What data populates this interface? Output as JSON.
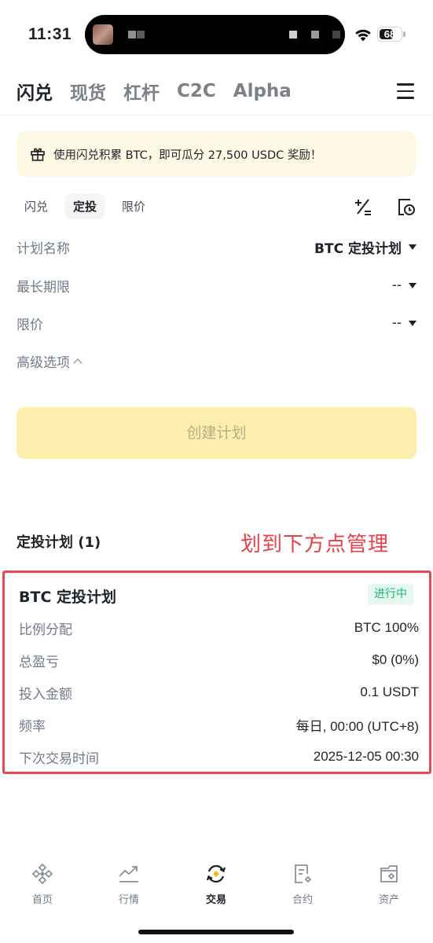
{
  "status_bar": {
    "time": "11:31",
    "battery": "68",
    "battery_level": 0.68
  },
  "top_tabs": [
    {
      "label": "闪兑",
      "active": true
    },
    {
      "label": "现货",
      "active": false
    },
    {
      "label": "杠杆",
      "active": false
    },
    {
      "label": "C2C",
      "active": false
    },
    {
      "label": "Alpha",
      "active": false
    }
  ],
  "promo": {
    "text": "使用闪兑积累 BTC，即可瓜分 27,500 USDC 奖励！",
    "icon": "gift-icon"
  },
  "sub_tabs": [
    {
      "label": "闪兑",
      "active": false
    },
    {
      "label": "定投",
      "active": true
    },
    {
      "label": "限价",
      "active": false
    }
  ],
  "form": {
    "plan_name_label": "计划名称",
    "plan_name_value": "BTC 定投计划",
    "max_period_label": "最长期限",
    "max_period_value": "--",
    "limit_price_label": "限价",
    "limit_price_value": "--",
    "advanced_label": "高级选项",
    "create_button": "创建计划"
  },
  "plans": {
    "title": "定投计划 (1)",
    "annotation": "划到下方点管理",
    "card": {
      "name": "BTC 定投计划",
      "status": "进行中",
      "rows": [
        {
          "label": "比例分配",
          "value": "BTC 100%"
        },
        {
          "label": "总盈亏",
          "value": "$0 (0%)"
        },
        {
          "label": "投入金额",
          "value": "0.1 USDT"
        },
        {
          "label": "频率",
          "value": "每日, 00:00 (UTC+8)"
        },
        {
          "label": "下次交易时间",
          "value": "2025-12-05 00:30"
        }
      ]
    }
  },
  "bottom_nav": [
    {
      "label": "首页",
      "icon": "home-diamond-icon",
      "active": false
    },
    {
      "label": "行情",
      "icon": "market-chart-icon",
      "active": false
    },
    {
      "label": "交易",
      "icon": "trade-swap-icon",
      "active": true
    },
    {
      "label": "合约",
      "icon": "futures-doc-icon",
      "active": false
    },
    {
      "label": "资产",
      "icon": "wallet-icon",
      "active": false
    }
  ],
  "colors": {
    "accent_yellow": "#fcd535",
    "annotation_red": "#e84048",
    "status_green": "#16b979"
  }
}
